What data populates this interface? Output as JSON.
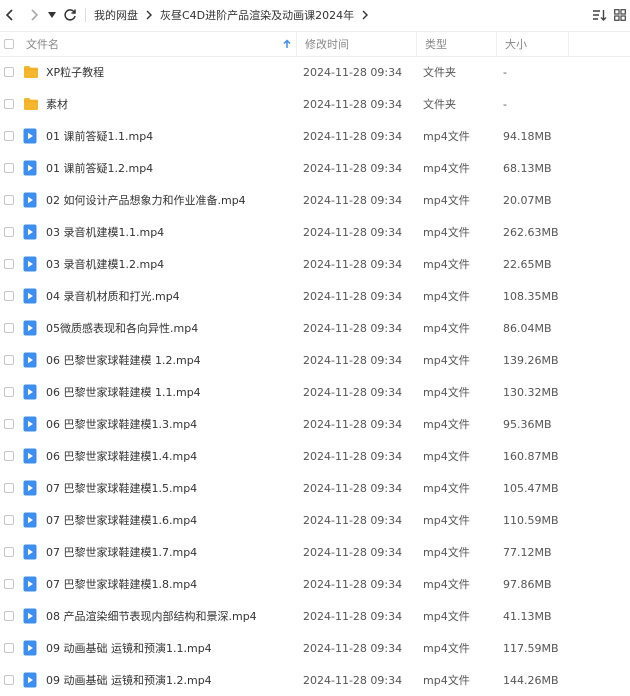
{
  "toolbar": {
    "breadcrumbs": [
      "我的网盘",
      "灰昼C4D进阶产品渲染及动画课2024年"
    ]
  },
  "columns": {
    "name": "文件名",
    "time": "修改时间",
    "type": "类型",
    "size": "大小"
  },
  "files": [
    {
      "name": "XP粒子教程",
      "time": "2024-11-28 09:34",
      "type": "文件夹",
      "size": "-",
      "icon": "folder-icon"
    },
    {
      "name": "素材",
      "time": "2024-11-28 09:34",
      "type": "文件夹",
      "size": "-",
      "icon": "folder-icon"
    },
    {
      "name": "01 课前答疑1.1.mp4",
      "time": "2024-11-28 09:34",
      "type": "mp4文件",
      "size": "94.18MB",
      "icon": "video-file-icon"
    },
    {
      "name": "01 课前答疑1.2.mp4",
      "time": "2024-11-28 09:34",
      "type": "mp4文件",
      "size": "68.13MB",
      "icon": "video-file-icon"
    },
    {
      "name": "02 如何设计产品想象力和作业准备.mp4",
      "time": "2024-11-28 09:34",
      "type": "mp4文件",
      "size": "20.07MB",
      "icon": "video-file-icon"
    },
    {
      "name": "03 录音机建模1.1.mp4",
      "time": "2024-11-28 09:34",
      "type": "mp4文件",
      "size": "262.63MB",
      "icon": "video-file-icon"
    },
    {
      "name": "03 录音机建模1.2.mp4",
      "time": "2024-11-28 09:34",
      "type": "mp4文件",
      "size": "22.65MB",
      "icon": "video-file-icon"
    },
    {
      "name": "04 录音机材质和打光.mp4",
      "time": "2024-11-28 09:34",
      "type": "mp4文件",
      "size": "108.35MB",
      "icon": "video-file-icon"
    },
    {
      "name": "05微质感表现和各向异性.mp4",
      "time": "2024-11-28 09:34",
      "type": "mp4文件",
      "size": "86.04MB",
      "icon": "video-file-icon"
    },
    {
      "name": "06 巴黎世家球鞋建模  1.2.mp4",
      "time": "2024-11-28 09:34",
      "type": "mp4文件",
      "size": "139.26MB",
      "icon": "video-file-icon"
    },
    {
      "name": "06 巴黎世家球鞋建模 1.1.mp4",
      "time": "2024-11-28 09:34",
      "type": "mp4文件",
      "size": "130.32MB",
      "icon": "video-file-icon"
    },
    {
      "name": "06 巴黎世家球鞋建模1.3.mp4",
      "time": "2024-11-28 09:34",
      "type": "mp4文件",
      "size": "95.36MB",
      "icon": "video-file-icon"
    },
    {
      "name": "06 巴黎世家球鞋建模1.4.mp4",
      "time": "2024-11-28 09:34",
      "type": "mp4文件",
      "size": "160.87MB",
      "icon": "video-file-icon"
    },
    {
      "name": "07 巴黎世家球鞋建模1.5.mp4",
      "time": "2024-11-28 09:34",
      "type": "mp4文件",
      "size": "105.47MB",
      "icon": "video-file-icon"
    },
    {
      "name": "07 巴黎世家球鞋建模1.6.mp4",
      "time": "2024-11-28 09:34",
      "type": "mp4文件",
      "size": "110.59MB",
      "icon": "video-file-icon"
    },
    {
      "name": "07 巴黎世家球鞋建模1.7.mp4",
      "time": "2024-11-28 09:34",
      "type": "mp4文件",
      "size": "77.12MB",
      "icon": "video-file-icon"
    },
    {
      "name": "07 巴黎世家球鞋建模1.8.mp4",
      "time": "2024-11-28 09:34",
      "type": "mp4文件",
      "size": "97.86MB",
      "icon": "video-file-icon"
    },
    {
      "name": "08 产品渲染细节表现内部结构和景深.mp4",
      "time": "2024-11-28 09:34",
      "type": "mp4文件",
      "size": "41.13MB",
      "icon": "video-file-icon"
    },
    {
      "name": "09 动画基础 运镜和预演1.1.mp4",
      "time": "2024-11-28 09:34",
      "type": "mp4文件",
      "size": "117.59MB",
      "icon": "video-file-icon"
    },
    {
      "name": "09 动画基础 运镜和预演1.2.mp4",
      "time": "2024-11-28 09:34",
      "type": "mp4文件",
      "size": "144.26MB",
      "icon": "video-file-icon"
    }
  ],
  "colors": {
    "folder": "#F5B62E",
    "video": "#3D8EF0",
    "sort_arrow": "#3D8EF0",
    "toolbar_icon": "#444444"
  }
}
